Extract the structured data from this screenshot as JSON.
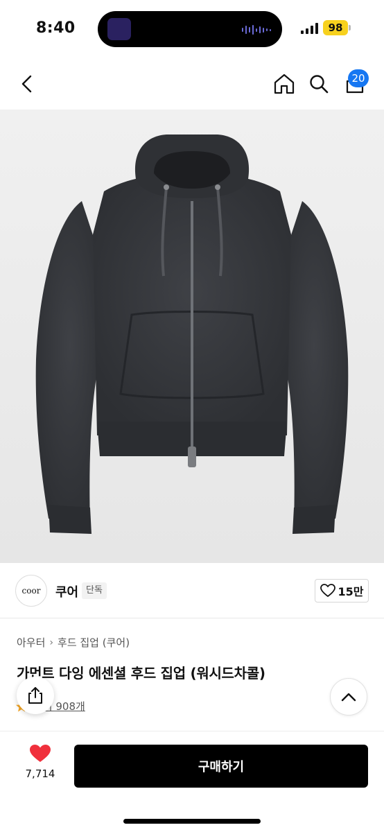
{
  "status_bar": {
    "time": "8:40",
    "battery": "98"
  },
  "header": {
    "cart_count": "20"
  },
  "brand": {
    "logo_text": "coor",
    "name": "쿠어",
    "tag": "단독",
    "like_count": "15만"
  },
  "breadcrumb": {
    "items": [
      "아우터",
      "후드 집업 (쿠어)"
    ]
  },
  "product": {
    "title": "가먼트 다잉 에센셜 후드 집업 (워시드차콜)",
    "review_label": "후기 908개"
  },
  "bottom": {
    "wish_count": "7,714",
    "buy_label": "구매하기"
  },
  "colors": {
    "accent_blue": "#1677f2",
    "battery_yellow": "#f7d11e",
    "heart_red": "#f0303c",
    "hoodie": "#35373b"
  },
  "icons": [
    "chevron-left-icon",
    "home-icon",
    "search-icon",
    "cart-icon",
    "heart-outline-icon",
    "share-icon",
    "chevron-up-icon",
    "heart-filled-icon",
    "star-icon"
  ]
}
